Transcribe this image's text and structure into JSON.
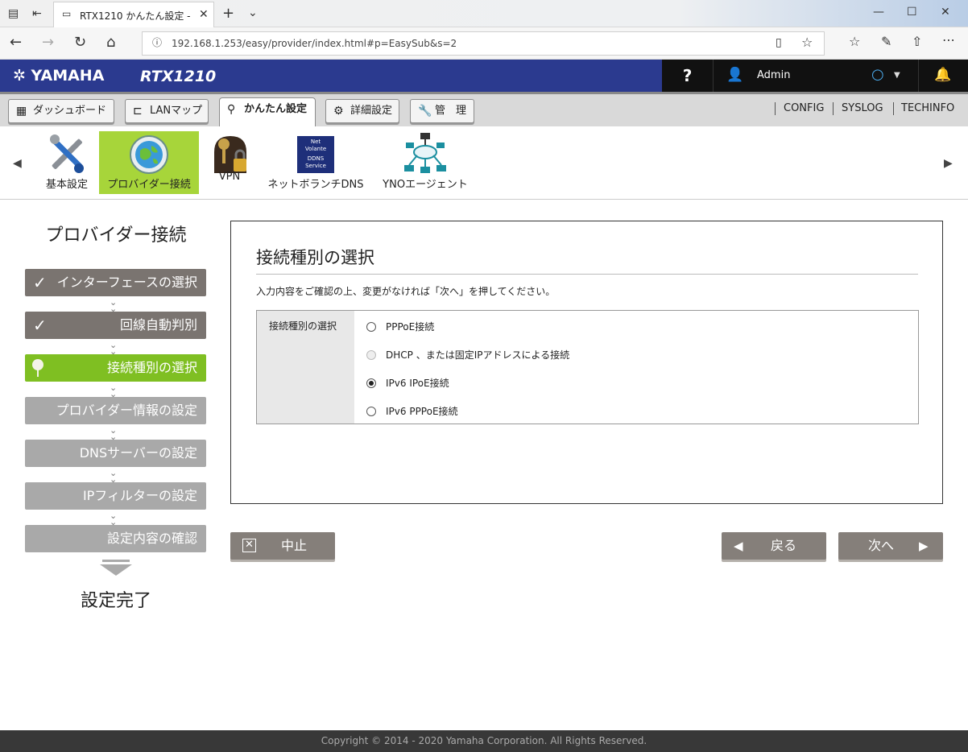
{
  "browser": {
    "tab_title": "RTX1210 かんたん設定 - ",
    "url": "192.168.1.253/easy/provider/index.html#p=EasySub&s=2"
  },
  "header": {
    "logo": "YAMAHA",
    "model": "RTX1210",
    "help": "?",
    "user": "Admin"
  },
  "menu": {
    "dashboard": "ダッシュボード",
    "lanmap": "LANマップ",
    "easy": "かんたん設定",
    "detail": "詳細設定",
    "manage": "管　理",
    "links": [
      "CONFIG",
      "SYSLOG",
      "TECHINFO"
    ]
  },
  "icons": [
    {
      "label": "基本設定",
      "icon": "tools-icon"
    },
    {
      "label": "プロバイダー接続",
      "icon": "globe-icon"
    },
    {
      "label": "VPN",
      "icon": "vpn-keys-icon"
    },
    {
      "label": "ネットボランチDNS",
      "icon": "ddns-service-icon"
    },
    {
      "label": "YNOエージェント",
      "icon": "network-cloud-icon"
    }
  ],
  "ddns_icon_text": [
    "Net",
    "Volante",
    "DDNS",
    "Service"
  ],
  "sidebar": {
    "title": "プロバイダー接続",
    "steps": [
      "インターフェースの選択",
      "回線自動判別",
      "接続種別の選択",
      "プロバイダー情報の設定",
      "DNSサーバーの設定",
      "IPフィルターの設定",
      "設定内容の確認"
    ],
    "finish": "設定完了"
  },
  "main": {
    "title": "接続種別の選択",
    "description": "入力内容をご確認の上、変更がなければ「次へ」を押してください。",
    "field_label": "接続種別の選択",
    "options": [
      {
        "label": "PPPoE接続",
        "state": "unselected"
      },
      {
        "label": "DHCP 、または固定IPアドレスによる接続",
        "state": "disabled"
      },
      {
        "label": "IPv6 IPoE接続",
        "state": "selected"
      },
      {
        "label": "IPv6 PPPoE接続",
        "state": "unselected"
      }
    ]
  },
  "buttons": {
    "cancel": "中止",
    "back": "戻る",
    "next": "次へ"
  },
  "footer": "Copyright © 2014 - 2020 Yamaha Corporation. All Rights Reserved.",
  "colors": {
    "header_blue": "#2b3a8f",
    "current_step_green": "#7fbf22",
    "selected_icon_green": "#a7d53a",
    "done_step": "#7a7470",
    "pending_step": "#a9a9a9"
  }
}
